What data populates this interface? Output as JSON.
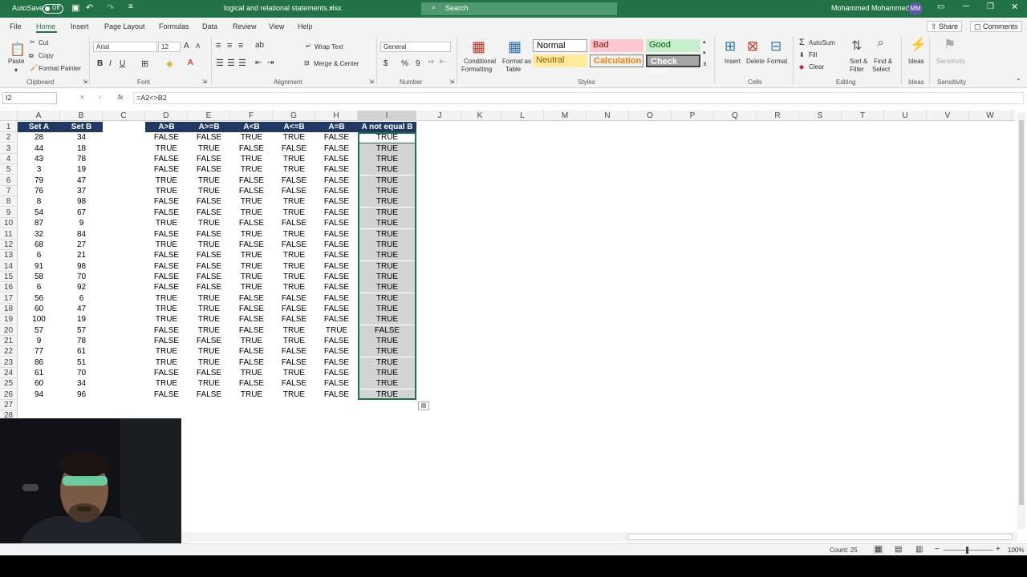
{
  "app": {
    "autosave_label": "AutoSave",
    "autosave_state": "Off",
    "filename": "logical and relational statements.xlsx",
    "search_label": "Search",
    "user_name": "Mohammed Mohammed",
    "user_initials": "MM"
  },
  "menu": {
    "items": [
      "File",
      "Home",
      "Insert",
      "Page Layout",
      "Formulas",
      "Data",
      "Review",
      "View",
      "Help"
    ],
    "active": "Home",
    "share": "Share",
    "comments": "Comments"
  },
  "ribbon": {
    "clipboard": {
      "paste": "Paste",
      "cut": "Cut",
      "copy": "Copy",
      "format_painter": "Format Painter",
      "group": "Clipboard"
    },
    "font": {
      "name": "Arial",
      "size": "12",
      "group": "Font",
      "bold": "B",
      "italic": "I",
      "underline": "U"
    },
    "alignment": {
      "wrap": "Wrap Text",
      "merge": "Merge & Center",
      "group": "Alignment"
    },
    "number": {
      "format": "General",
      "group": "Number",
      "currency": "$",
      "percent": "%",
      "comma": "9"
    },
    "styles": {
      "cond1": "Conditional",
      "cond2": "Formatting",
      "fmt1": "Format as",
      "fmt2": "Table",
      "normal": "Normal",
      "bad": "Bad",
      "good": "Good",
      "neutral": "Neutral",
      "calculation": "Calculation",
      "check": "Check Cell",
      "group": "Styles"
    },
    "cells": {
      "insert": "Insert",
      "delete": "Delete",
      "format": "Format",
      "group": "Cells"
    },
    "editing": {
      "autosum": "AutoSum",
      "fill": "Fill",
      "clear": "Clear",
      "sort1": "Sort &",
      "sort2": "Filter",
      "find1": "Find &",
      "find2": "Select",
      "group": "Editing"
    },
    "ideas": {
      "label": "Ideas",
      "group": "Ideas"
    },
    "sensitivity": {
      "label": "Sensitivity",
      "group": "Sensitivity"
    }
  },
  "formula_bar": {
    "name_box": "I2",
    "formula": "=A2<>B2",
    "fx": "fx"
  },
  "sheet": {
    "columns": [
      "A",
      "B",
      "C",
      "D",
      "E",
      "F",
      "G",
      "H",
      "I",
      "J",
      "K",
      "L",
      "M",
      "N",
      "O",
      "P",
      "Q",
      "R",
      "S",
      "T",
      "U",
      "V",
      "W"
    ],
    "selected_column": "I",
    "row_numbers": [
      "1",
      "2",
      "3",
      "4",
      "5",
      "6",
      "7",
      "8",
      "9",
      "10",
      "11",
      "12",
      "13",
      "14",
      "15",
      "16",
      "17",
      "18",
      "19",
      "20",
      "21",
      "22",
      "23",
      "24",
      "25",
      "26",
      "27",
      "28"
    ],
    "headers": {
      "A": "Set A",
      "B": "Set B",
      "D": "A>B",
      "E": "A>=B",
      "F": "A<B",
      "G": "A<=B",
      "H": "A=B",
      "I": "A not equal B"
    },
    "rows": [
      [
        "28",
        "34",
        "FALSE",
        "FALSE",
        "TRUE",
        "TRUE",
        "FALSE",
        "TRUE"
      ],
      [
        "44",
        "18",
        "TRUE",
        "TRUE",
        "FALSE",
        "FALSE",
        "FALSE",
        "TRUE"
      ],
      [
        "43",
        "78",
        "FALSE",
        "FALSE",
        "TRUE",
        "TRUE",
        "FALSE",
        "TRUE"
      ],
      [
        "3",
        "19",
        "FALSE",
        "FALSE",
        "TRUE",
        "TRUE",
        "FALSE",
        "TRUE"
      ],
      [
        "79",
        "47",
        "TRUE",
        "TRUE",
        "FALSE",
        "FALSE",
        "FALSE",
        "TRUE"
      ],
      [
        "76",
        "37",
        "TRUE",
        "TRUE",
        "FALSE",
        "FALSE",
        "FALSE",
        "TRUE"
      ],
      [
        "8",
        "98",
        "FALSE",
        "FALSE",
        "TRUE",
        "TRUE",
        "FALSE",
        "TRUE"
      ],
      [
        "54",
        "67",
        "FALSE",
        "FALSE",
        "TRUE",
        "TRUE",
        "FALSE",
        "TRUE"
      ],
      [
        "87",
        "9",
        "TRUE",
        "TRUE",
        "FALSE",
        "FALSE",
        "FALSE",
        "TRUE"
      ],
      [
        "32",
        "84",
        "FALSE",
        "FALSE",
        "TRUE",
        "TRUE",
        "FALSE",
        "TRUE"
      ],
      [
        "68",
        "27",
        "TRUE",
        "TRUE",
        "FALSE",
        "FALSE",
        "FALSE",
        "TRUE"
      ],
      [
        "6",
        "21",
        "FALSE",
        "FALSE",
        "TRUE",
        "TRUE",
        "FALSE",
        "TRUE"
      ],
      [
        "91",
        "98",
        "FALSE",
        "FALSE",
        "TRUE",
        "TRUE",
        "FALSE",
        "TRUE"
      ],
      [
        "58",
        "70",
        "FALSE",
        "FALSE",
        "TRUE",
        "TRUE",
        "FALSE",
        "TRUE"
      ],
      [
        "6",
        "92",
        "FALSE",
        "FALSE",
        "TRUE",
        "TRUE",
        "FALSE",
        "TRUE"
      ],
      [
        "56",
        "6",
        "TRUE",
        "TRUE",
        "FALSE",
        "FALSE",
        "FALSE",
        "TRUE"
      ],
      [
        "60",
        "47",
        "TRUE",
        "TRUE",
        "FALSE",
        "FALSE",
        "FALSE",
        "TRUE"
      ],
      [
        "100",
        "19",
        "TRUE",
        "TRUE",
        "FALSE",
        "FALSE",
        "FALSE",
        "TRUE"
      ],
      [
        "57",
        "57",
        "FALSE",
        "TRUE",
        "FALSE",
        "TRUE",
        "TRUE",
        "FALSE"
      ],
      [
        "9",
        "78",
        "FALSE",
        "FALSE",
        "TRUE",
        "TRUE",
        "FALSE",
        "TRUE"
      ],
      [
        "77",
        "61",
        "TRUE",
        "TRUE",
        "FALSE",
        "FALSE",
        "FALSE",
        "TRUE"
      ],
      [
        "86",
        "51",
        "TRUE",
        "TRUE",
        "FALSE",
        "FALSE",
        "FALSE",
        "TRUE"
      ],
      [
        "61",
        "70",
        "FALSE",
        "FALSE",
        "TRUE",
        "TRUE",
        "FALSE",
        "TRUE"
      ],
      [
        "60",
        "34",
        "TRUE",
        "TRUE",
        "FALSE",
        "FALSE",
        "FALSE",
        "TRUE"
      ],
      [
        "94",
        "96",
        "FALSE",
        "FALSE",
        "TRUE",
        "TRUE",
        "FALSE",
        "TRUE"
      ]
    ]
  },
  "status": {
    "count": "Count: 25",
    "zoom": "100%"
  },
  "colors": {
    "excel_green": "#217346",
    "header_fill": "#1f3864",
    "selection_gray": "#d3d3d3"
  }
}
